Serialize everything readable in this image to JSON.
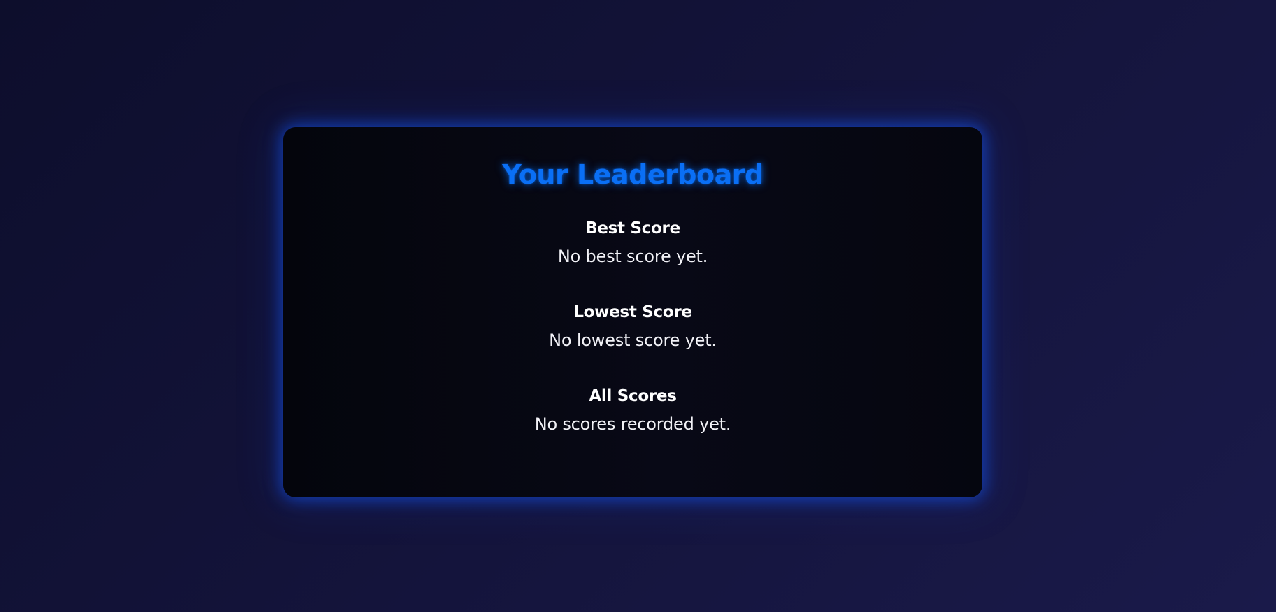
{
  "leaderboard": {
    "title": "Your Leaderboard",
    "accent_color": "#0a6ff5",
    "sections": [
      {
        "heading": "Best Score",
        "text": "No best score yet."
      },
      {
        "heading": "Lowest Score",
        "text": "No lowest score yet."
      },
      {
        "heading": "All Scores",
        "text": "No scores recorded yet."
      }
    ]
  }
}
